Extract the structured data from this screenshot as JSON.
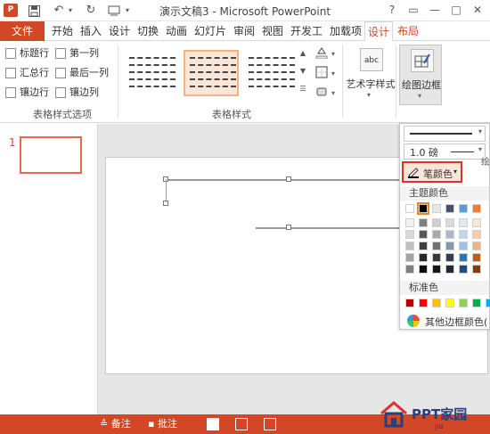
{
  "titlebar": {
    "app_icon": "P",
    "title": "演示文稿3 - Microsoft PowerPoint",
    "qat": [
      "save-icon",
      "undo-icon",
      "redo-icon",
      "customize-icon"
    ],
    "window": {
      "help": "?",
      "ribbon_options": "▭",
      "minimize": "—",
      "maximize": "□",
      "close": "✕"
    }
  },
  "tabs": {
    "file": "文件",
    "items": [
      "开始",
      "插入",
      "设计",
      "切换",
      "动画",
      "幻灯片",
      "审阅",
      "视图",
      "开发工",
      "加载项"
    ],
    "contextual": [
      "设计",
      "布局"
    ]
  },
  "ribbon": {
    "table_style_options": {
      "label": "表格样式选项",
      "options": [
        {
          "label": "标题行",
          "checked": false
        },
        {
          "label": "第一列",
          "checked": false
        },
        {
          "label": "汇总行",
          "checked": false
        },
        {
          "label": "最后一列",
          "checked": false
        },
        {
          "label": "镶边行",
          "checked": false
        },
        {
          "label": "镶边列",
          "checked": false
        }
      ]
    },
    "table_styles": {
      "label": "表格样式"
    },
    "wordart": {
      "icon_text": "abc",
      "label": "艺术字样式"
    },
    "draw_borders": {
      "label": "绘图边框"
    }
  },
  "slide_panel": {
    "slide_number": "1"
  },
  "dropdown": {
    "weight": "1.0 磅",
    "pen_color": "笔颜色",
    "theme_colors_label": "主题颜色",
    "standard_colors_label": "标准色",
    "more_colors": "其他边框颜色(",
    "side_label": "绘",
    "theme_top_row": [
      "#ffffff",
      "#000000",
      "#e7e6e6",
      "#44546a",
      "#5b9bd5",
      "#ed7d31"
    ],
    "theme_shades": [
      [
        "#f2f2f2",
        "#7f7f7f",
        "#d0cece",
        "#d6dce4",
        "#deebf6",
        "#fbe5d5"
      ],
      [
        "#d8d8d8",
        "#595959",
        "#aeaaaa",
        "#adb9ca",
        "#bdd7ee",
        "#f7cbac"
      ],
      [
        "#bfbfbf",
        "#3f3f3f",
        "#757070",
        "#8496b0",
        "#9dc3e6",
        "#f4b183"
      ],
      [
        "#a5a5a5",
        "#262626",
        "#3a3838",
        "#323f4f",
        "#2e75b5",
        "#c55a11"
      ],
      [
        "#7f7f7f",
        "#0c0c0c",
        "#171616",
        "#222a35",
        "#1e4e79",
        "#843c0b"
      ]
    ],
    "standard_colors": [
      "#c00000",
      "#ff0000",
      "#ffc000",
      "#ffff00",
      "#92d050",
      "#00b050",
      "#00b0f0"
    ]
  },
  "statusbar": {
    "notes": "备注",
    "comments": "批注"
  },
  "watermark": {
    "text": "PPT家园",
    "sub": "jia"
  }
}
